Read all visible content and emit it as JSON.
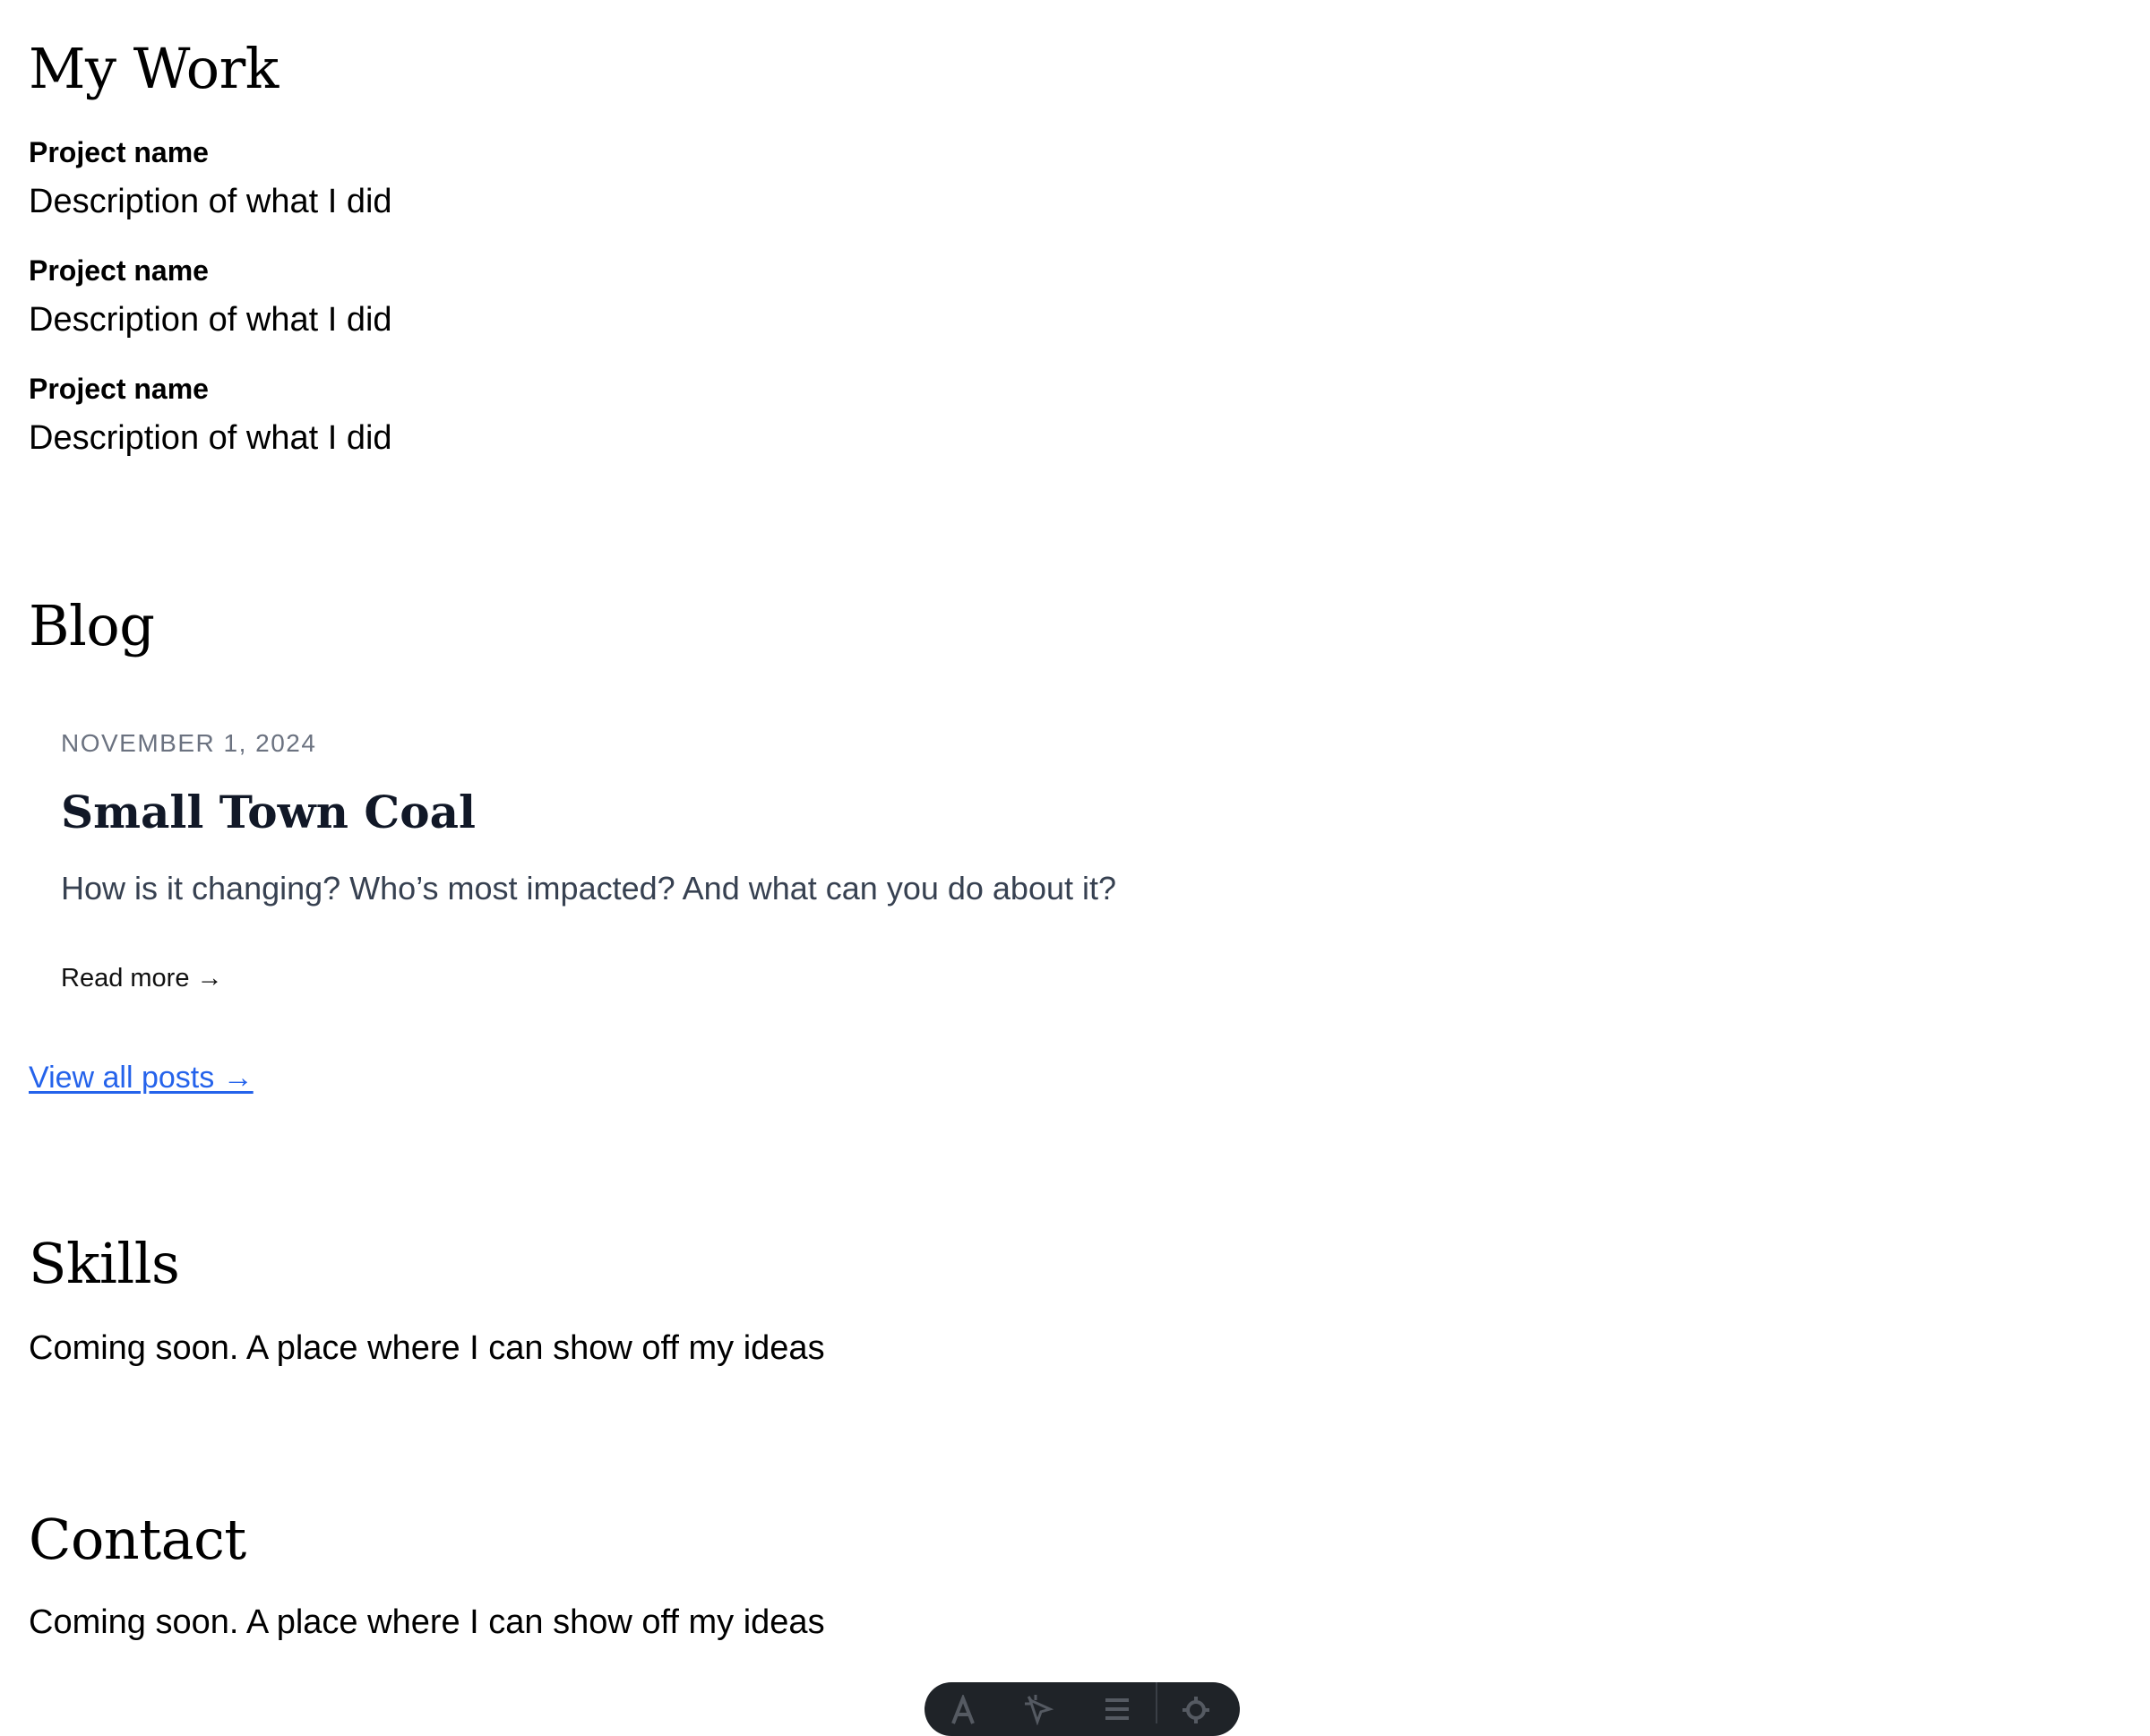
{
  "work": {
    "title": "My Work",
    "projects": [
      {
        "name": "Project name",
        "description": "Description of what I did"
      },
      {
        "name": "Project name",
        "description": "Description of what I did"
      },
      {
        "name": "Project name",
        "description": "Description of what I did"
      }
    ]
  },
  "blog": {
    "title": "Blog",
    "posts": [
      {
        "date": "NOVEMBER 1, 2024",
        "title": "Small Town Coal",
        "excerpt": "How is it changing? Who’s most impacted? And what can you do about it?",
        "read_more": "Read more →"
      }
    ],
    "view_all": "View all posts →"
  },
  "skills": {
    "title": "Skills",
    "text": "Coming soon. A place where I can show off my ideas"
  },
  "contact": {
    "title": "Contact",
    "text": "Coming soon. A place where I can show off my ideas"
  },
  "toolbar": {
    "icons": [
      "font-icon",
      "pointer-icon",
      "menu-icon",
      "gear-icon"
    ]
  },
  "colors": {
    "link": "#2563eb",
    "muted_date": "#6b7280",
    "excerpt": "#374151",
    "post_title": "#111827",
    "toolbar_bg": "#1f2328"
  }
}
